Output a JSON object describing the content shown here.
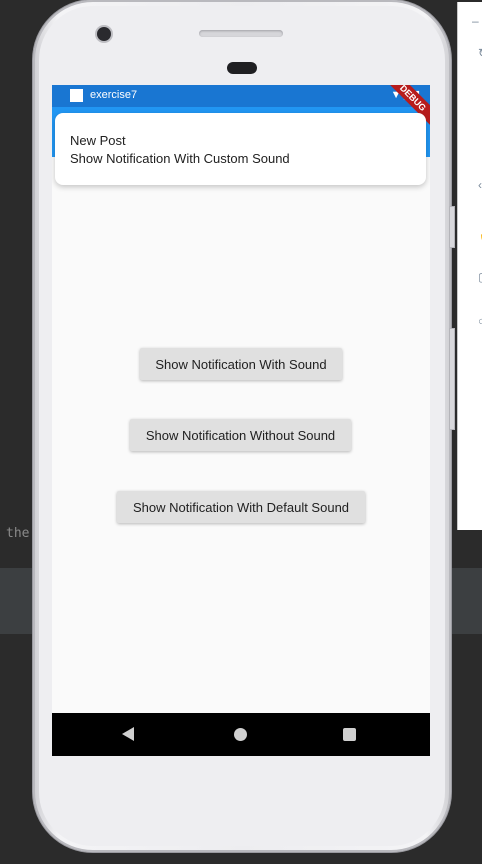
{
  "ide": {
    "code_fragment": "the"
  },
  "status_bar": {
    "app_name": "exercise7",
    "icons": "▼◢▮"
  },
  "debug_banner": {
    "label": "DEBUG"
  },
  "notification": {
    "title": "New Post",
    "body": "Show Notification With Custom Sound"
  },
  "buttons": {
    "with_sound": "Show Notification With Sound",
    "without_sound": "Show Notification Without Sound",
    "default_sound": "Show Notification With Default Sound"
  },
  "colors": {
    "status_bar": "#1976d2",
    "app_bar": "#2196f3",
    "button_bg": "#e0e0e0",
    "debug": "#b71c1c"
  }
}
